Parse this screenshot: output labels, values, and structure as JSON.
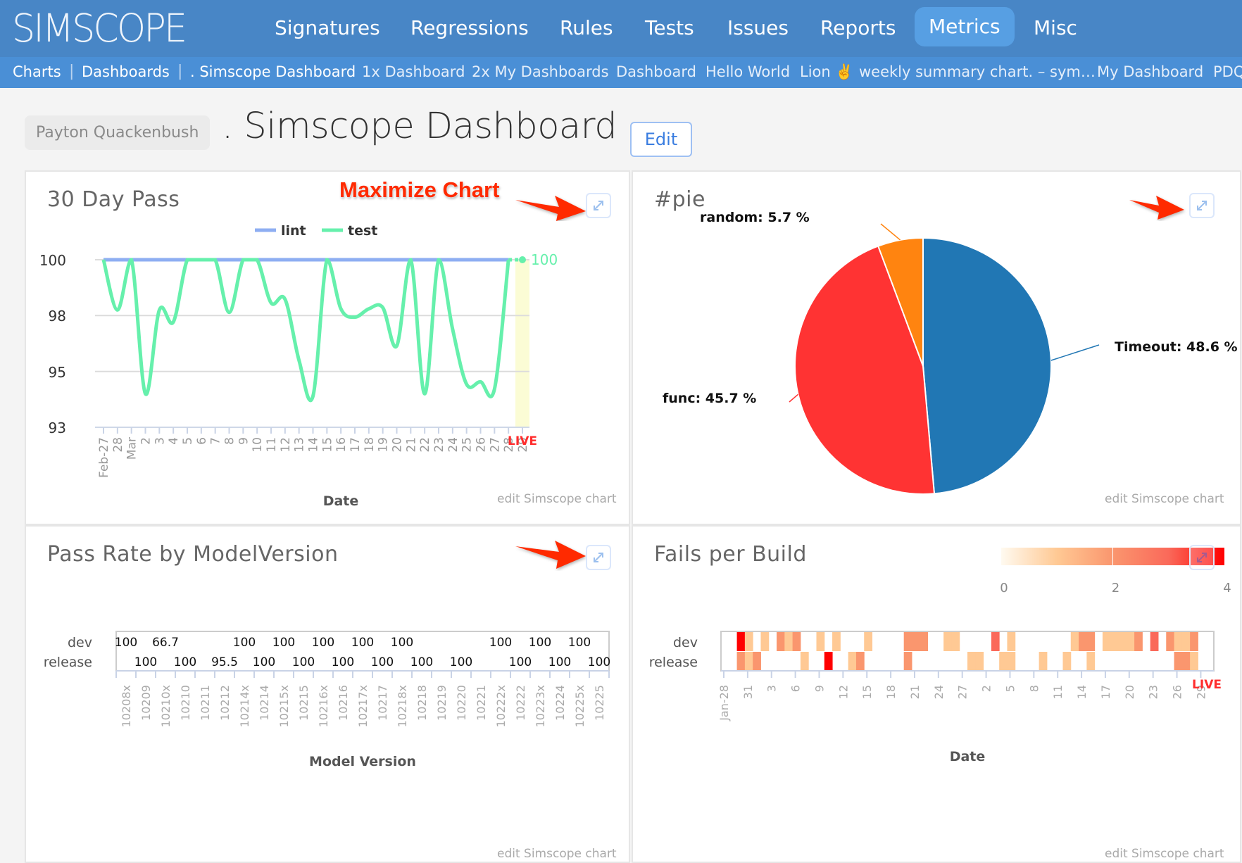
{
  "app": {
    "logo": "SIMSCOPE",
    "nav": [
      {
        "label": "Signatures",
        "active": false
      },
      {
        "label": "Regressions",
        "active": false
      },
      {
        "label": "Rules",
        "active": false
      },
      {
        "label": "Tests",
        "active": false
      },
      {
        "label": "Issues",
        "active": false
      },
      {
        "label": "Reports",
        "active": false
      },
      {
        "label": "Metrics",
        "active": true
      },
      {
        "label": "Misc",
        "active": false
      }
    ],
    "subnav": {
      "charts": "Charts",
      "dashboards": "Dashboards",
      "separator": "|",
      "items": [
        ". Simscope Dashboard",
        "1x Dashboard",
        "2x My Dashboards",
        "Dashboard",
        "Hello World",
        "Lion",
        "✌️",
        "weekly summary chart. – sym…",
        "My Dashboard",
        "PDQ"
      ]
    }
  },
  "page": {
    "owner": "Payton Quackenbush",
    "title": ". Simscope Dashboard",
    "edit_label": "Edit",
    "annotation": "Maximize Chart",
    "edit_chart_link": "edit Simscope chart"
  },
  "colors": {
    "nav_bg": "#4886c6",
    "subnav_bg": "#4a8fd6",
    "active_nav": "#579fe3",
    "lint": "#8eaef2",
    "test": "#66f0ac",
    "live": "#ff2d2d",
    "pie_timeout": "#2177b4",
    "pie_func": "#ff3333",
    "pie_random": "#ff8410",
    "annotation": "#ff2a00"
  },
  "chart_data": [
    {
      "id": "pass30",
      "type": "line",
      "title": "30 Day Pass",
      "xlabel": "Date",
      "ylabel": "",
      "ylim": [
        93,
        100
      ],
      "yticks": [
        100,
        97.67,
        95.33,
        93
      ],
      "ytick_labels": [
        "100",
        "98",
        "95",
        "93"
      ],
      "grid": true,
      "legend": "top-center",
      "x": [
        "Feb-27",
        "28",
        "Mar",
        "2",
        "3",
        "4",
        "5",
        "6",
        "7",
        "8",
        "9",
        "10",
        "11",
        "12",
        "13",
        "14",
        "15",
        "16",
        "17",
        "18",
        "19",
        "20",
        "21",
        "22",
        "23",
        "24",
        "25",
        "26",
        "27",
        "28",
        "29"
      ],
      "live_label": "LIVE",
      "last_value_label": "100",
      "series": [
        {
          "name": "lint",
          "values": [
            100,
            100,
            100,
            100,
            100,
            100,
            100,
            100,
            100,
            100,
            100,
            100,
            100,
            100,
            100,
            100,
            100,
            100,
            100,
            100,
            100,
            100,
            100,
            100,
            100,
            100,
            100,
            100,
            100,
            100,
            100
          ]
        },
        {
          "name": "test",
          "values": [
            100,
            97.9,
            100,
            94.4,
            97.9,
            97.4,
            100,
            100,
            100,
            97.8,
            100,
            100,
            98.2,
            98.35,
            95.8,
            94.3,
            100,
            97.95,
            97.6,
            97.95,
            98.0,
            96.4,
            100,
            94.4,
            100,
            97.1,
            94.8,
            94.9,
            94.6,
            100,
            100
          ]
        }
      ]
    },
    {
      "id": "pie",
      "type": "pie",
      "title": "#pie",
      "slices": [
        {
          "label": "Timeout",
          "value": 48.6,
          "text": "Timeout: 48.6 %"
        },
        {
          "label": "func",
          "value": 45.7,
          "text": "func: 45.7 %"
        },
        {
          "label": "random",
          "value": 5.7,
          "text": "random: 5.7 %"
        }
      ]
    },
    {
      "id": "passrate",
      "type": "heatmap",
      "title": "Pass Rate by ModelVersion",
      "xlabel": "Model Version",
      "rows": [
        "dev",
        "release"
      ],
      "categories": [
        "10208x",
        "10209",
        "10210x",
        "10210",
        "10211",
        "10212",
        "10214x",
        "10214",
        "10215x",
        "10215",
        "10216x",
        "10216",
        "10217x",
        "10217",
        "10218x",
        "10218",
        "10219",
        "10220",
        "10221",
        "10222x",
        "10222",
        "10223x",
        "10224",
        "10225x",
        "10225"
      ],
      "cells": [
        {
          "row": "dev",
          "col": 0,
          "value": "100"
        },
        {
          "row": "dev",
          "col": 2,
          "value": "66.7"
        },
        {
          "row": "dev",
          "col": 6,
          "value": "100"
        },
        {
          "row": "dev",
          "col": 8,
          "value": "100"
        },
        {
          "row": "dev",
          "col": 10,
          "value": "100"
        },
        {
          "row": "dev",
          "col": 12,
          "value": "100"
        },
        {
          "row": "dev",
          "col": 14,
          "value": "100"
        },
        {
          "row": "dev",
          "col": 19,
          "value": "100"
        },
        {
          "row": "dev",
          "col": 21,
          "value": "100"
        },
        {
          "row": "dev",
          "col": 23,
          "value": "100"
        },
        {
          "row": "release",
          "col": 1,
          "value": "100"
        },
        {
          "row": "release",
          "col": 3,
          "value": "100"
        },
        {
          "row": "release",
          "col": 5,
          "value": "95.5"
        },
        {
          "row": "release",
          "col": 7,
          "value": "100"
        },
        {
          "row": "release",
          "col": 9,
          "value": "100"
        },
        {
          "row": "release",
          "col": 11,
          "value": "100"
        },
        {
          "row": "release",
          "col": 13,
          "value": "100"
        },
        {
          "row": "release",
          "col": 15,
          "value": "100"
        },
        {
          "row": "release",
          "col": 17,
          "value": "100"
        },
        {
          "row": "release",
          "col": 20,
          "value": "100"
        },
        {
          "row": "release",
          "col": 22,
          "value": "100"
        },
        {
          "row": "release",
          "col": 24,
          "value": "100"
        }
      ]
    },
    {
      "id": "fails",
      "type": "heatmap",
      "title": "Fails per Build",
      "xlabel": "Date",
      "rows": [
        "dev",
        "release"
      ],
      "days": 62,
      "xticks": [
        "Jan-28",
        "31",
        "3",
        "6",
        "9",
        "12",
        "15",
        "18",
        "21",
        "24",
        "27",
        "2",
        "5",
        "8",
        "11",
        "14",
        "17",
        "20",
        "23",
        "26",
        "29"
      ],
      "xtick_step_days": 3,
      "live_label": "LIVE",
      "colorbar": {
        "min": 0,
        "max": 4,
        "ticks": [
          "0",
          "2",
          "4"
        ]
      },
      "cells": {
        "dev": [
          [
            2,
            4
          ],
          [
            3,
            1
          ],
          [
            5,
            1
          ],
          [
            7,
            2
          ],
          [
            8,
            1
          ],
          [
            9,
            2
          ],
          [
            12,
            1
          ],
          [
            14,
            1
          ],
          [
            18,
            1
          ],
          [
            23,
            2
          ],
          [
            24,
            2
          ],
          [
            25,
            2
          ],
          [
            28,
            1
          ],
          [
            29,
            1
          ],
          [
            34,
            3
          ],
          [
            36,
            1
          ],
          [
            44,
            1
          ],
          [
            45,
            2
          ],
          [
            46,
            2
          ],
          [
            48,
            1
          ],
          [
            49,
            1
          ],
          [
            50,
            1
          ],
          [
            51,
            1
          ],
          [
            52,
            2
          ],
          [
            54,
            3
          ],
          [
            56,
            2
          ],
          [
            57,
            1
          ],
          [
            58,
            1
          ],
          [
            59,
            2
          ]
        ],
        "release": [
          [
            2,
            2
          ],
          [
            3,
            1
          ],
          [
            4,
            2
          ],
          [
            10,
            1
          ],
          [
            13,
            4
          ],
          [
            16,
            1
          ],
          [
            17,
            2
          ],
          [
            23,
            2
          ],
          [
            31,
            1
          ],
          [
            32,
            1
          ],
          [
            35,
            1
          ],
          [
            36,
            1
          ],
          [
            40,
            1
          ],
          [
            43,
            1
          ],
          [
            46,
            1
          ],
          [
            57,
            2
          ],
          [
            58,
            2
          ],
          [
            59,
            1
          ]
        ]
      }
    }
  ]
}
